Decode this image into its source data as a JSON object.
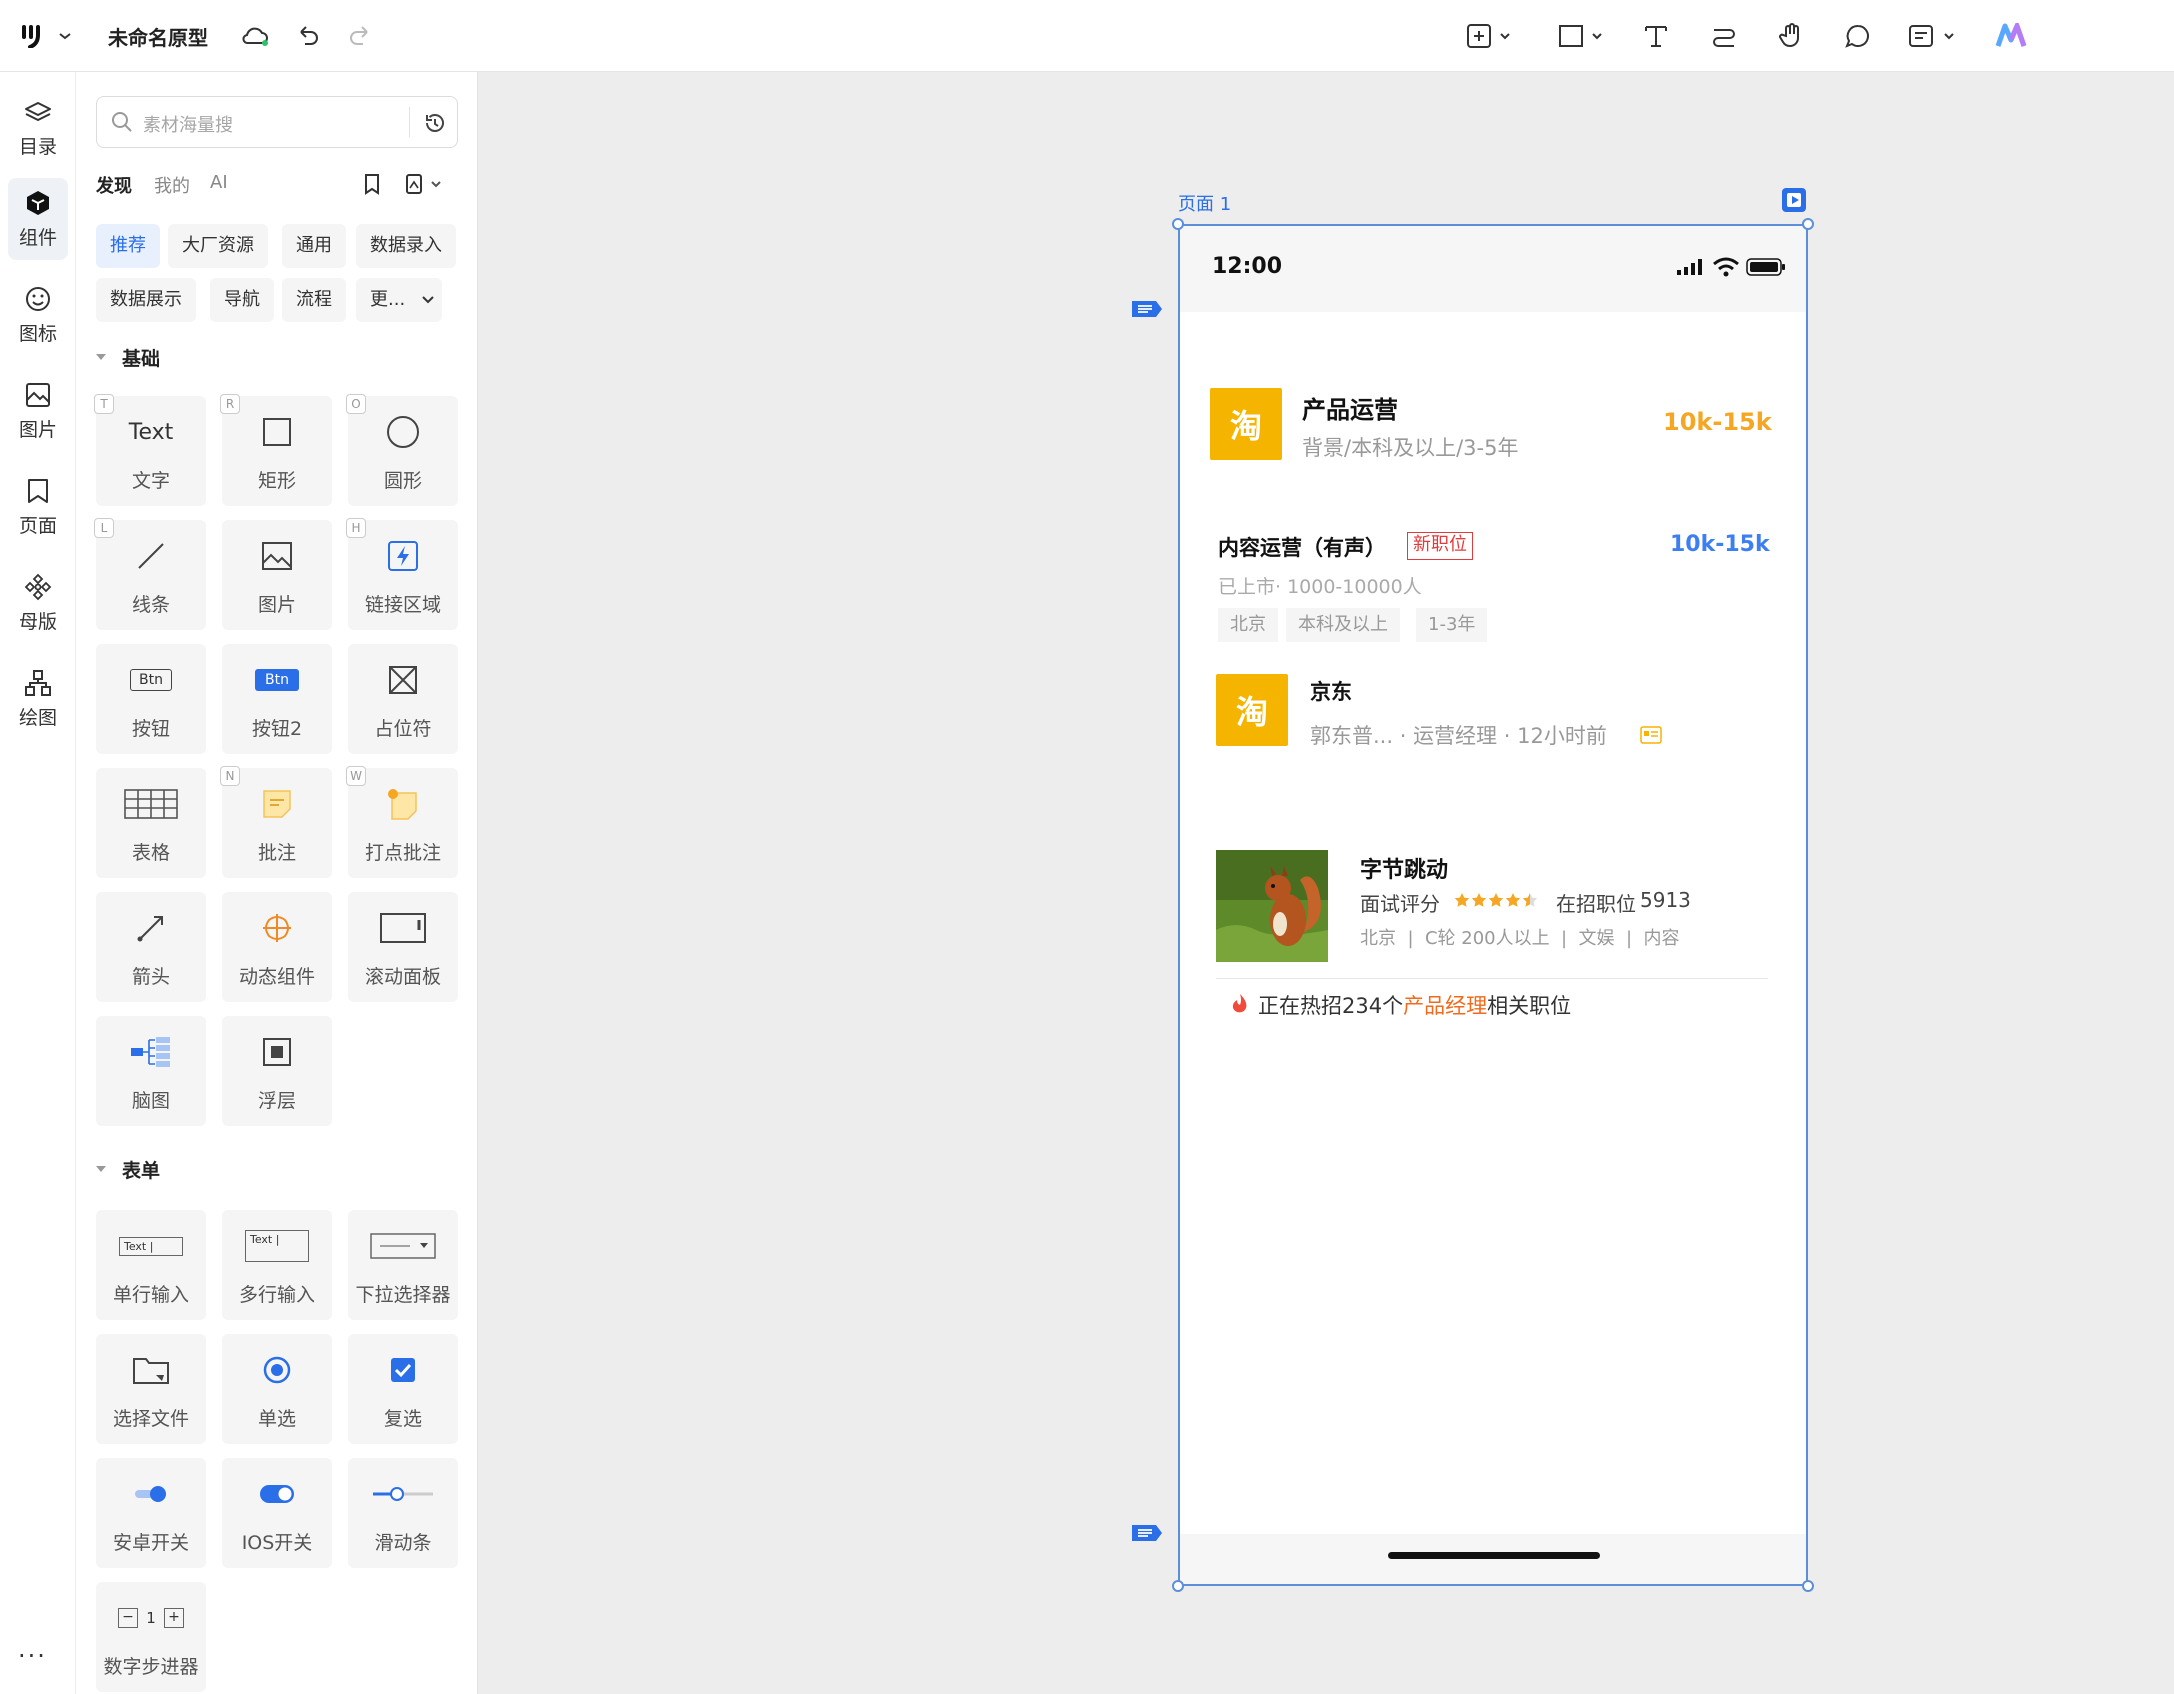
{
  "app": {
    "title": "未命名原型"
  },
  "rail": {
    "items": [
      {
        "label": "目录",
        "icon": "layers-icon"
      },
      {
        "label": "组件",
        "icon": "cube-icon"
      },
      {
        "label": "图标",
        "icon": "smiley-icon"
      },
      {
        "label": "图片",
        "icon": "image-icon"
      },
      {
        "label": "页面",
        "icon": "bookmark-page-icon"
      },
      {
        "label": "母版",
        "icon": "master-icon"
      },
      {
        "label": "绘图",
        "icon": "shapes-icon"
      }
    ],
    "more": "···"
  },
  "panel": {
    "search_placeholder": "素材海量搜",
    "tabs": [
      "发现",
      "我的",
      "AI"
    ],
    "chips_row1": [
      "推荐",
      "大厂资源",
      "通用",
      "数据录入"
    ],
    "chips_row2": [
      "数据展示",
      "导航",
      "流程",
      "更..."
    ],
    "section_basic": "基础",
    "basic": [
      {
        "label": "文字",
        "key": "T",
        "icon_text": "Text"
      },
      {
        "label": "矩形",
        "key": "R"
      },
      {
        "label": "圆形",
        "key": "O"
      },
      {
        "label": "线条",
        "key": "L"
      },
      {
        "label": "图片",
        "key": ""
      },
      {
        "label": "链接区域",
        "key": "H"
      },
      {
        "label": "按钮",
        "key": "",
        "icon_text": "Btn"
      },
      {
        "label": "按钮2",
        "key": "",
        "icon_text": "Btn"
      },
      {
        "label": "占位符",
        "key": ""
      },
      {
        "label": "表格",
        "key": ""
      },
      {
        "label": "批注",
        "key": "N"
      },
      {
        "label": "打点批注",
        "key": "W"
      },
      {
        "label": "箭头",
        "key": ""
      },
      {
        "label": "动态组件",
        "key": ""
      },
      {
        "label": "滚动面板",
        "key": ""
      },
      {
        "label": "脑图",
        "key": ""
      },
      {
        "label": "浮层",
        "key": ""
      }
    ],
    "section_form": "表单",
    "form": [
      {
        "label": "单行输入",
        "icon_text": "Text |"
      },
      {
        "label": "多行输入",
        "icon_text": "Text |"
      },
      {
        "label": "下拉选择器"
      },
      {
        "label": "选择文件"
      },
      {
        "label": "单选"
      },
      {
        "label": "复选"
      },
      {
        "label": "安卓开关"
      },
      {
        "label": "IOS开关"
      },
      {
        "label": "滑动条"
      },
      {
        "label": "数字步进器",
        "stepper_value": "1"
      }
    ]
  },
  "canvas": {
    "page_label": "页面 1",
    "phone": {
      "time": "12:00",
      "job1": {
        "logo": "淘",
        "title": "产品运营",
        "meta": "背景/本科及以上/3-5年",
        "salary": "10k-15k"
      },
      "job2": {
        "title": "内容运营（有声）",
        "badge": "新职位",
        "salary": "10k-15k",
        "company_meta": "已上市· 1000-10000人",
        "tags": [
          "北京",
          "本科及以上",
          "1-3年"
        ],
        "logo": "淘",
        "company": "京东",
        "recruiter": "郭东普...",
        "role": "运营经理",
        "time": "12小时前"
      },
      "job3": {
        "company": "字节跳动",
        "rating_label": "面试评分",
        "open_label": "在招职位",
        "open_count": "5913",
        "rating": 4.5,
        "details": "北京  |  C轮 200人以上  |  文娱  |  内容",
        "hot_prefix": "正在热招234个",
        "hot_keyword": "产品经理",
        "hot_suffix": "相关职位"
      }
    }
  },
  "colors": {
    "accent": "#2a6ee8",
    "brand_orange": "#f5b400",
    "salary_blue": "#3d7ff0",
    "hot": "#f26a1b"
  }
}
